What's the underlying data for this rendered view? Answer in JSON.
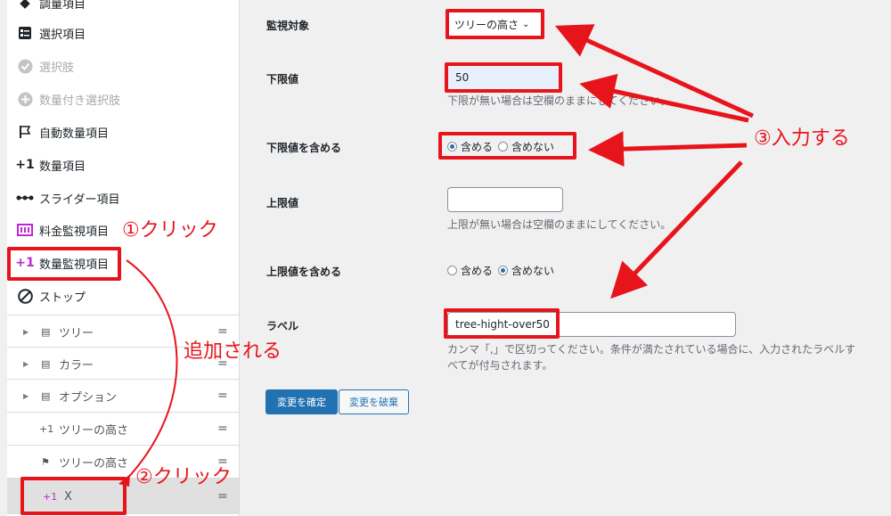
{
  "palette": {
    "items": [
      {
        "label": "調量項目",
        "icon": "diamond-icon",
        "disabled": false
      },
      {
        "label": "選択項目",
        "icon": "select-list-icon",
        "disabled": false
      },
      {
        "label": "選択肢",
        "icon": "check-circle-icon",
        "disabled": true
      },
      {
        "label": "数量付き選択肢",
        "icon": "plus-circle-icon",
        "disabled": true
      },
      {
        "label": "自動数量項目",
        "icon": "flag-icon",
        "disabled": false
      },
      {
        "label": "数量項目",
        "icon": "plus-one-icon",
        "disabled": false
      },
      {
        "label": "スライダー項目",
        "icon": "slider-dots-icon",
        "disabled": false
      },
      {
        "label": "料金監視項目",
        "icon": "price-monitor-icon",
        "disabled": false
      },
      {
        "label": "数量監視項目",
        "icon": "plus-one-icon",
        "disabled": false
      },
      {
        "label": "ストップ",
        "icon": "stop-icon",
        "disabled": false
      }
    ]
  },
  "tree": {
    "rows": [
      {
        "label": "ツリー",
        "icon": "select-list-icon",
        "expandable": true
      },
      {
        "label": "カラー",
        "icon": "select-list-icon",
        "expandable": true
      },
      {
        "label": "オプション",
        "icon": "select-list-icon",
        "expandable": true
      },
      {
        "label": "ツリーの高さ",
        "icon": "plus-one-icon",
        "expandable": false
      },
      {
        "label": "ツリーの高さ",
        "icon": "flag-icon",
        "expandable": false
      },
      {
        "label": "X",
        "icon": "plus-one-icon",
        "expandable": false,
        "selected": true
      }
    ],
    "drag_glyph": "="
  },
  "form": {
    "monitor_target": {
      "label": "監視対象",
      "value": "ツリーの高さ"
    },
    "lower_limit": {
      "label": "下限値",
      "value": "50",
      "help": "下限が無い場合は空欄のままにしてください。"
    },
    "include_lower": {
      "label": "下限値を含める",
      "options": [
        "含める",
        "含めない"
      ],
      "selected": 0
    },
    "upper_limit": {
      "label": "上限値",
      "value": "",
      "help": "上限が無い場合は空欄のままにしてください。"
    },
    "include_upper": {
      "label": "上限値を含める",
      "options": [
        "含める",
        "含めない"
      ],
      "selected": 1
    },
    "label_field": {
      "label": "ラベル",
      "value": "tree-hight-over50",
      "help_line1": "カンマ「,」で区切ってください。条件が満たされている場合に、入力されたラベルす",
      "help_line2": "べてが付与されます。"
    },
    "confirm_button": "変更を確定",
    "discard_button": "変更を破棄"
  },
  "annotations": {
    "click1": "①クリック",
    "added": "追加される",
    "click2": "②クリック",
    "input3": "③入力する"
  },
  "colors": {
    "annotation_red": "#e8141b",
    "primary_blue": "#2271b1",
    "purple_icon": "#c026d3"
  }
}
